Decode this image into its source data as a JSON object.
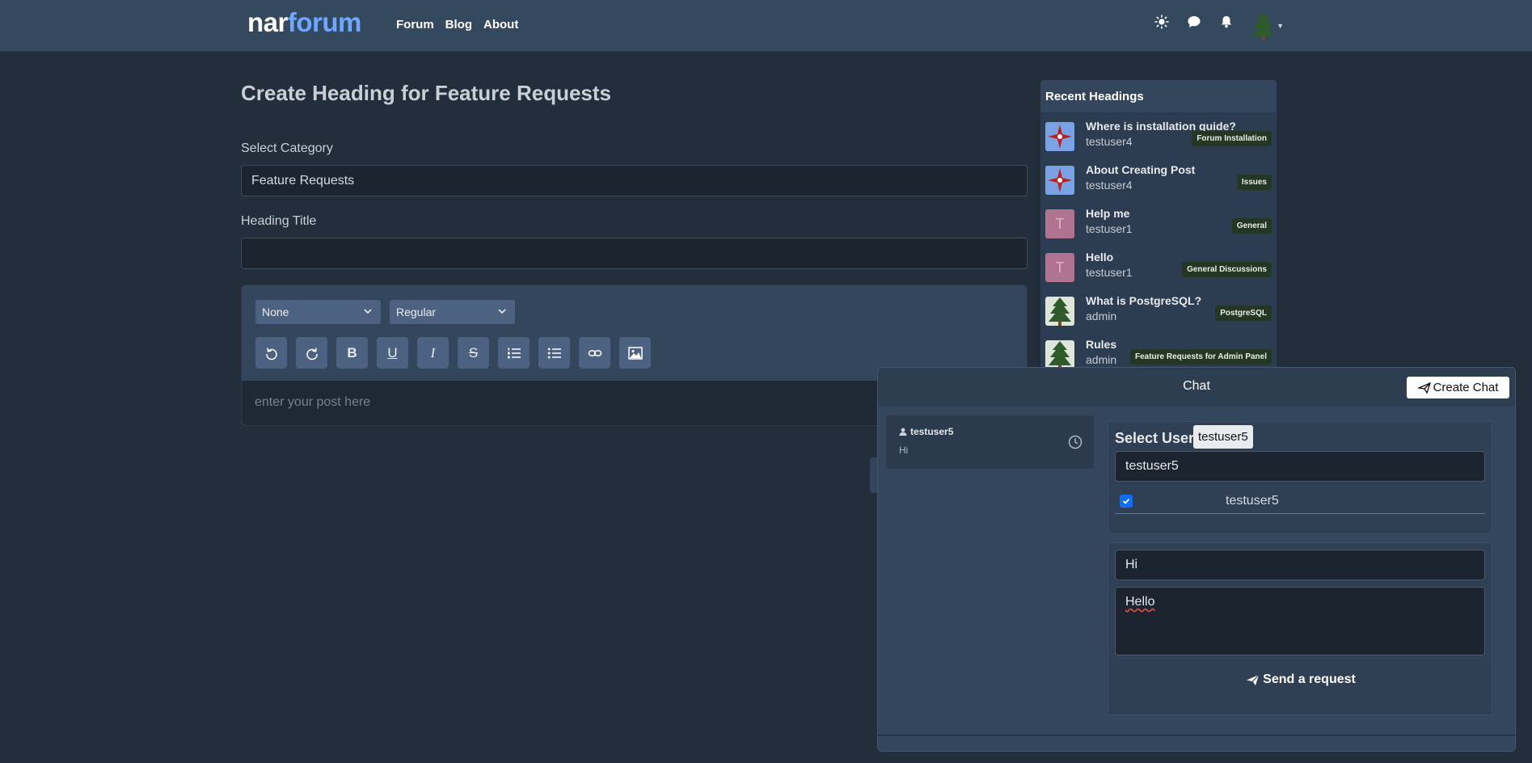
{
  "nav": {
    "brand_part1": "nar",
    "brand_part2": "forum",
    "links": [
      "Forum",
      "Blog",
      "About"
    ],
    "icons": [
      "sun-icon",
      "chat-bubble-icon",
      "bell-icon",
      "tree-avatar-icon"
    ]
  },
  "form": {
    "title": "Create Heading for Feature Requests",
    "category_label": "Select Category",
    "category_value": "Feature Requests",
    "heading_label": "Heading Title",
    "heading_value": "",
    "editor": {
      "font_select": "None",
      "weight_select": "Regular",
      "toolbar": [
        "undo",
        "redo",
        "bold",
        "underline",
        "italic",
        "strikethrough",
        "ordered-list",
        "unordered-list",
        "link",
        "image"
      ],
      "bold_glyph": "B",
      "underline_glyph": "U",
      "italic_glyph": "I",
      "strike_glyph": "S",
      "placeholder": "enter your post here"
    }
  },
  "recent": {
    "title": "Recent Headings",
    "items": [
      {
        "title": "Where is installation guide?",
        "user": "testuser4",
        "badge": "Forum Installation",
        "avatar": "compass"
      },
      {
        "title": "About Creating Post",
        "user": "testuser4",
        "badge": "Issues",
        "avatar": "compass"
      },
      {
        "title": "Help me",
        "user": "testuser1",
        "badge": "General",
        "avatar": "T"
      },
      {
        "title": "Hello",
        "user": "testuser1",
        "badge": "General Discussions",
        "avatar": "T"
      },
      {
        "title": "What is PostgreSQL?",
        "user": "admin",
        "badge": "PostgreSQL",
        "avatar": "tree"
      },
      {
        "title": "Rules",
        "user": "admin",
        "badge": "Feature Requests for Admin Panel",
        "avatar": "tree"
      }
    ]
  },
  "chat": {
    "title": "Chat",
    "create_label": "Create Chat",
    "conversation": {
      "user": "testuser5",
      "message": "Hi"
    },
    "select_user_label": "Select User",
    "selected_chip": "testuser5",
    "search_value": "testuser5",
    "result_user": "testuser5",
    "result_checked": true,
    "subject_value": "Hi",
    "message_value": "Hello",
    "send_label": "Send a request"
  },
  "colors": {
    "navbar": "#34495e",
    "background": "#222e3c",
    "brand_accent": "#6ea8fe",
    "badge": "#243624",
    "checkbox": "#0d6efd"
  }
}
